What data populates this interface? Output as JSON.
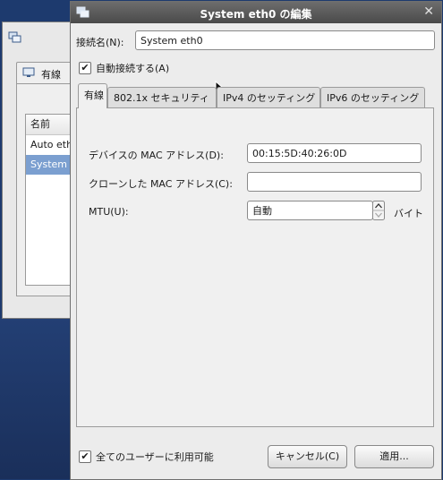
{
  "background_window": {
    "tab_label": "有線",
    "list_header": "名前",
    "rows": [
      "Auto eth",
      "System"
    ]
  },
  "dialog": {
    "title": "System eth0 の編集",
    "close_glyph": "✕",
    "connection_name_label": "接続名(N):",
    "connection_name_value": "System eth0",
    "auto_connect_label": "自動接続する(A)",
    "auto_connect_checked": true,
    "tabs": [
      {
        "label": "有線",
        "active": true
      },
      {
        "label": "802.1x セキュリティ",
        "active": false
      },
      {
        "label": "IPv4 のセッティング",
        "active": false
      },
      {
        "label": "IPv6 のセッティング",
        "active": false
      }
    ],
    "wired": {
      "mac_label": "デバイスの MAC アドレス(D):",
      "mac_value": "00:15:5D:40:26:0D",
      "cloned_mac_label": "クローンした MAC アドレス(C):",
      "cloned_mac_value": "",
      "mtu_label": "MTU(U):",
      "mtu_value": "自動",
      "mtu_unit": "バイト"
    },
    "all_users_label": "全てのユーザーに利用可能",
    "all_users_checked": true,
    "cancel_button": "キャンセル(C)",
    "apply_button": "適用..."
  },
  "icons": {
    "title": "network-connection-icon",
    "background_window": "network-connection-icon",
    "wired_tab": "wired-network-icon",
    "close": "close-icon",
    "checkmark": "checkmark-icon",
    "spin": "spin-arrows-icon",
    "cursor": "mouse-cursor-icon"
  },
  "colors": {
    "titlebar": "#555555",
    "desktop": "#1d3a6e",
    "selection": "#7b9fd0"
  }
}
